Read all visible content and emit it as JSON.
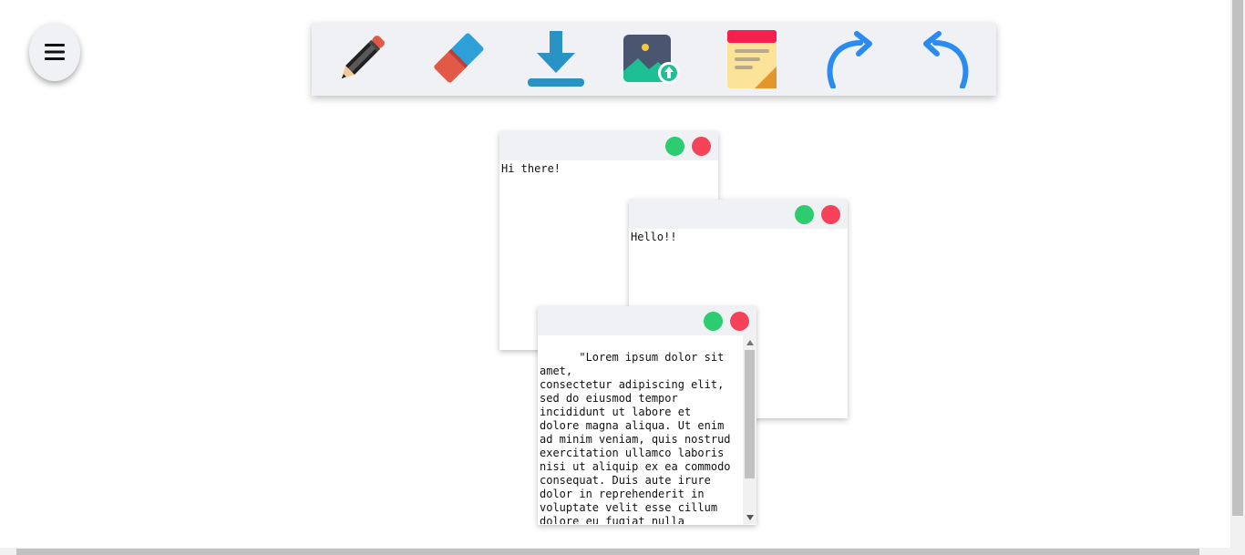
{
  "menu": {
    "icon": "hamburger-icon"
  },
  "toolbar": {
    "tools": [
      {
        "name": "pencil-icon"
      },
      {
        "name": "eraser-icon"
      },
      {
        "name": "download-icon"
      },
      {
        "name": "image-upload-icon"
      },
      {
        "name": "sticky-note-icon"
      },
      {
        "name": "redo-icon"
      },
      {
        "name": "undo-icon"
      }
    ]
  },
  "notes": [
    {
      "text": "Hi there!"
    },
    {
      "text": "Hello!!"
    },
    {
      "text": "\"Lorem ipsum dolor sit amet,\nconsectetur adipiscing elit,\nsed do eiusmod tempor\nincididunt ut labore et\ndolore magna aliqua. Ut enim\nad minim veniam, quis nostrud\nexercitation ullamco laboris\nnisi ut aliquip ex ea commodo\nconsequat. Duis aute irure\ndolor in reprehenderit in\nvoluptate velit esse cillum\ndolore eu fugiat nulla\npariatur. Excepteur sint\noccaecat cupidatat non"
    }
  ],
  "colors": {
    "green_dot": "#2ecc71",
    "red_dot": "#f7435a",
    "toolbar_bg": "#f0f1f4",
    "accent_blue": "#2a8cf0"
  }
}
